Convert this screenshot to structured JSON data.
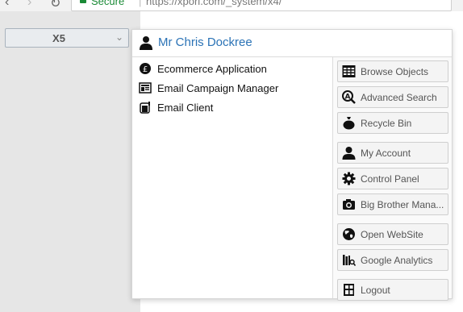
{
  "browser": {
    "secure_label": "Secure",
    "url": "https://xpori.com/_system/x4/"
  },
  "app_selector": {
    "value": "X5"
  },
  "user_menu": {
    "name": "Mr Chris Dockree",
    "apps": [
      {
        "label": "Ecommerce Application",
        "icon": "pound-coin-icon"
      },
      {
        "label": "Email Campaign Manager",
        "icon": "newsletter-icon"
      },
      {
        "label": "Email Client",
        "icon": "mailbox-icon"
      }
    ],
    "actions": [
      {
        "label": "Browse Objects",
        "icon": "grid-table-icon"
      },
      {
        "label": "Advanced Search",
        "icon": "search-a-icon"
      },
      {
        "label": "Recycle Bin",
        "icon": "money-bag-icon"
      },
      {
        "label": "My Account",
        "icon": "user-icon"
      },
      {
        "label": "Control Panel",
        "icon": "gear-icon"
      },
      {
        "label": "Big Brother Mana...",
        "icon": "camera-icon"
      },
      {
        "label": "Open WebSite",
        "icon": "globe-icon"
      },
      {
        "label": "Google Analytics",
        "icon": "books-magnifier-icon"
      },
      {
        "label": "Logout",
        "icon": "logout-icon"
      }
    ]
  }
}
